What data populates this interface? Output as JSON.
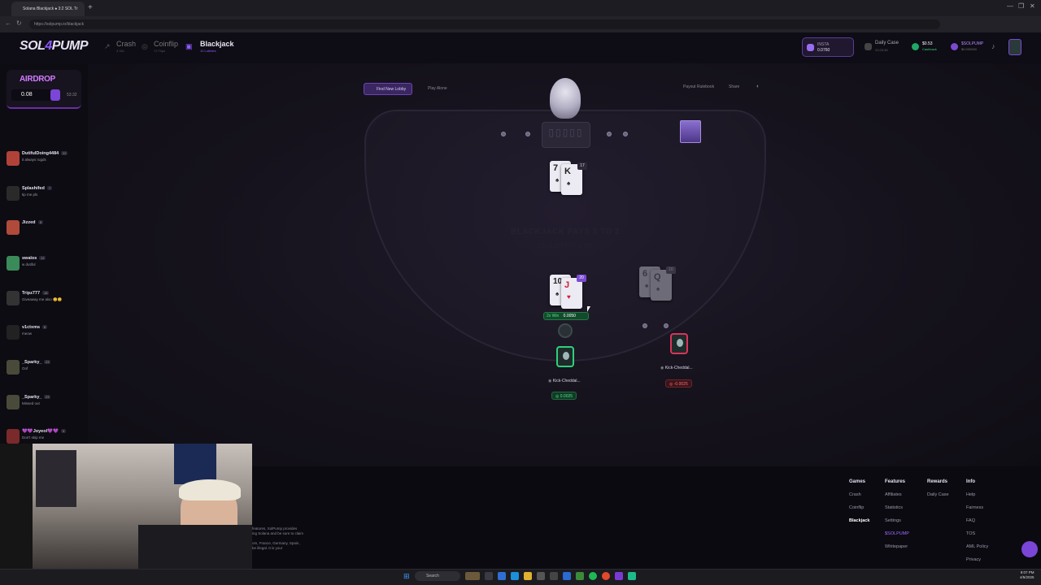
{
  "browser": {
    "tab_title": "Solana Blackjack ♠ 3:2 SOL Tr",
    "url": "https://solpump.io/blackjack",
    "newtab": "+",
    "controls": [
      "—",
      "❐",
      "✕"
    ]
  },
  "header": {
    "logo_text_a": "SOL",
    "logo_text_b": "4",
    "logo_text_c": "PUMP",
    "games": [
      {
        "name": "Crash",
        "sub": "3.33x",
        "icon": "rocket-icon"
      },
      {
        "name": "Coinflip",
        "sub": "72 Flips",
        "icon": "coin-icon"
      },
      {
        "name": "Blackjack",
        "sub": "10 Lobbies",
        "icon": "cards-icon"
      }
    ],
    "balance_label": "INSTA",
    "balance_value": "0.0760",
    "daily_case_label": "Daily Case",
    "daily_case_sub": "23:23:35",
    "cashback_label": "$0.53",
    "cashback_sub": "Cashback",
    "solpump_label": "$SOLPUMP",
    "solpump_sub": "$0.000000"
  },
  "sidebar": {
    "airdrop_title": "AIRDROP",
    "airdrop_value": "0.08",
    "airdrop_timer": "53:32",
    "chat": [
      {
        "name": "DutifulDoing4484",
        "level": "22",
        "text": "it always rugds",
        "color": "#b0423a"
      },
      {
        "name": "Splashifed",
        "level": "7",
        "text": "tip me pls",
        "color": "#2a2a2a"
      },
      {
        "name": "Jizzed",
        "level": "8",
        "text": "",
        "color": "#b04a3a"
      },
      {
        "name": "swalos",
        "level": "12",
        "text": "w dutiful",
        "color": "#3b8a5a"
      },
      {
        "name": "Tripz777",
        "level": "18",
        "text": "Giveaway me also 😊😊",
        "color": "#333"
      },
      {
        "name": "v1ctxms",
        "level": "8",
        "text": "meow",
        "color": "#222"
      },
      {
        "name": "_Sparky_",
        "level": "23",
        "text": "Oof",
        "color": "#4a4a3a"
      },
      {
        "name": "_Sparky_",
        "level": "23",
        "text": "Missed out",
        "color": "#4a4a3a"
      },
      {
        "name": "💜💜Joyeol💜💜",
        "level": "9",
        "text": "Don't skip me",
        "color": "#7a2a2a"
      }
    ]
  },
  "table": {
    "find_lobby": "Find New Lobby",
    "play_alone": "Play Alone",
    "payout": "Payout Rulebook",
    "share": "Share",
    "felt_line1": "BLACKJACK PAYS 3 TO 2",
    "felt_line2": "DEALER PAYS TIE",
    "dealer_cards": [
      {
        "rank": "7",
        "suit": "♠"
      },
      {
        "rank": "K",
        "suit": "♠"
      }
    ],
    "dealer_total": "17",
    "player1_cards": [
      {
        "rank": "10",
        "suit": "♠"
      },
      {
        "rank": "J",
        "suit": "♥"
      }
    ],
    "player1_total": "20",
    "win_multiplier": "2x Win",
    "win_amount": "0.0050",
    "player1_name": "Kick-Cheddal...",
    "player1_bet": "0.0025",
    "player2_cards": [
      {
        "rank": "6",
        "suit": "♠"
      },
      {
        "rank": "Q",
        "suit": "♠"
      }
    ],
    "player2_total": "16",
    "player2_name": "Kick-Cheddal...",
    "player2_bet": "-0.0025"
  },
  "footer": {
    "cols": [
      {
        "head": "Games",
        "items": [
          "Crash",
          "Coinflip",
          "Blackjack"
        ]
      },
      {
        "head": "Features",
        "items": [
          "Affiliates",
          "Statistics",
          "Settings",
          "$SOLPUMP",
          "Whitepaper"
        ]
      },
      {
        "head": "Rewards",
        "items": [
          "",
          "Daily Case"
        ]
      },
      {
        "head": "Info",
        "items": [
          "Help",
          "Fairness",
          "FAQ",
          "TOS",
          "AML Policy",
          "Privacy"
        ]
      }
    ],
    "note1": "features, SolPump provides",
    "note2": "ing Solana and be sure to claim",
    "note3": "om, France, Germany, Spain,",
    "note4": "be illegal. It is your"
  },
  "taskbar": {
    "search": "Search",
    "time": "9:07 PM",
    "date": "4/5/2025"
  }
}
